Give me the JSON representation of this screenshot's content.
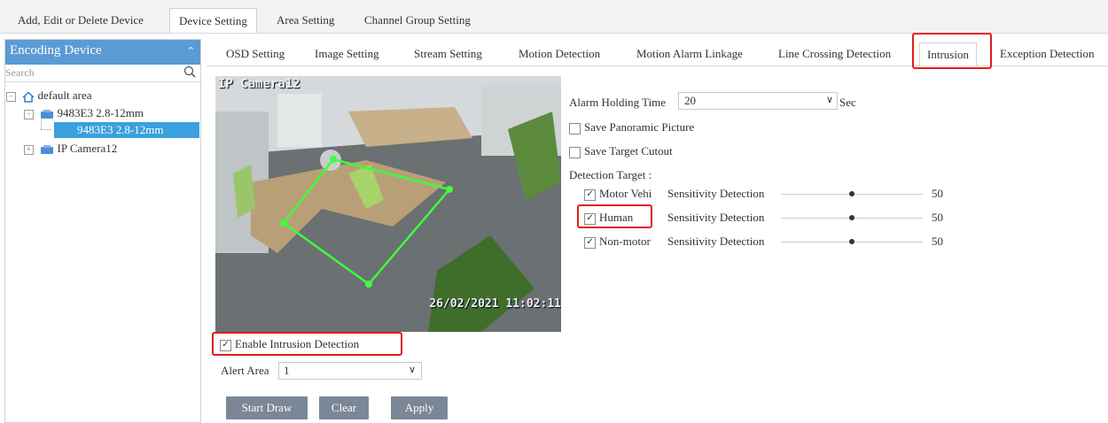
{
  "top_tabs": [
    "Add, Edit or Delete Device",
    "Device Setting",
    "Area Setting",
    "Channel Group Setting"
  ],
  "left_panel": {
    "title": "Encoding Device",
    "search_placeholder": "Search",
    "tree": {
      "area": "default area",
      "device": "9483E3 2.8-12mm",
      "channel": "9483E3 2.8-12mm",
      "camera": "IP Camera12"
    }
  },
  "sub_tabs": [
    "OSD Setting",
    "Image Setting",
    "Stream Setting",
    "Motion Detection",
    "Motion Alarm Linkage",
    "Line Crossing Detection",
    "Intrusion",
    "Exception Detection"
  ],
  "video": {
    "camera_name": "IP Camera12",
    "timestamp": "26/02/2021 11:02:11"
  },
  "enable_intrusion": {
    "label": "Enable Intrusion Detection",
    "checked": true
  },
  "alert_area": {
    "label": "Alert Area",
    "value": "1"
  },
  "buttons": {
    "start_draw": "Start Draw",
    "clear": "Clear",
    "apply": "Apply"
  },
  "settings": {
    "alarm_holding_label": "Alarm Holding Time",
    "alarm_holding_value": "20",
    "alarm_holding_unit": "Sec",
    "save_panoramic": "Save Panoramic Picture",
    "save_target": "Save Target Cutout",
    "detection_target_label": "Detection Target :",
    "targets": [
      {
        "name": "Motor Vehi",
        "sensitivity_label": "Sensitivity Detection",
        "value": "50",
        "level": 0.5
      },
      {
        "name": "Human",
        "sensitivity_label": "Sensitivity Detection",
        "value": "50",
        "level": 0.5
      },
      {
        "name": "Non-motor",
        "sensitivity_label": "Sensitivity Detection",
        "value": "50",
        "level": 0.5
      }
    ]
  },
  "colors": {
    "accent": "#5b9bd5",
    "highlight_red": "#e21b1b",
    "button_bg": "#7b8796",
    "zone_green": "#3cff3c"
  },
  "icons": {
    "search": "search-icon",
    "home": "home-icon",
    "camera": "camera-icon",
    "dropdown": "chevron-down-icon",
    "collapse": "chevron-up-icon"
  }
}
